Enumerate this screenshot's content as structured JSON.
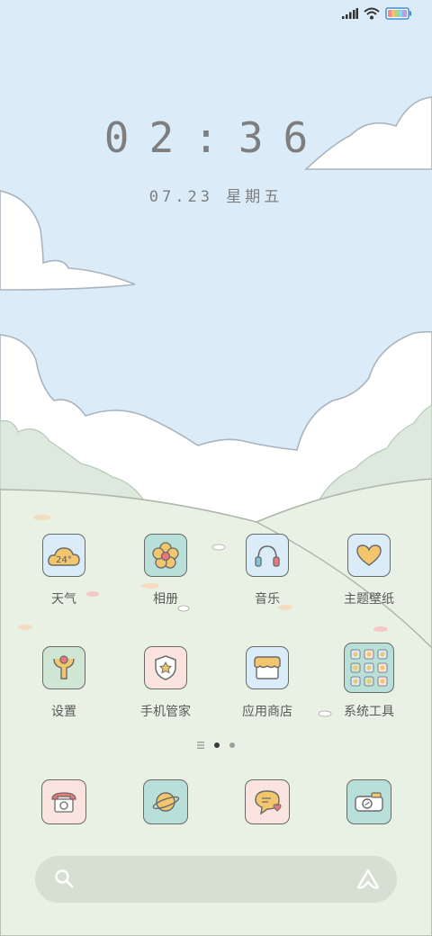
{
  "clock": {
    "time": "02:36",
    "date": "07.23 星期五"
  },
  "apps": [
    {
      "label": "天气",
      "temp": "24°"
    },
    {
      "label": "相册"
    },
    {
      "label": "音乐"
    },
    {
      "label": "主题壁纸"
    },
    {
      "label": "设置"
    },
    {
      "label": "手机管家"
    },
    {
      "label": "应用商店"
    },
    {
      "label": "系统工具"
    }
  ],
  "pager": {
    "pages": 2,
    "current": 1
  },
  "dock": [
    {
      "name": "phone"
    },
    {
      "name": "browser"
    },
    {
      "name": "messages"
    },
    {
      "name": "camera"
    }
  ],
  "colors": {
    "sky": "#dcecf8",
    "grass": "#e8efe3",
    "tile_blue": "#d9ecf8",
    "tile_teal": "#b9dfd9",
    "tile_pink": "#fbe4df",
    "tile_green": "#cfe6d5",
    "accent_yellow": "#f2c66d",
    "accent_red": "#e9787a"
  }
}
